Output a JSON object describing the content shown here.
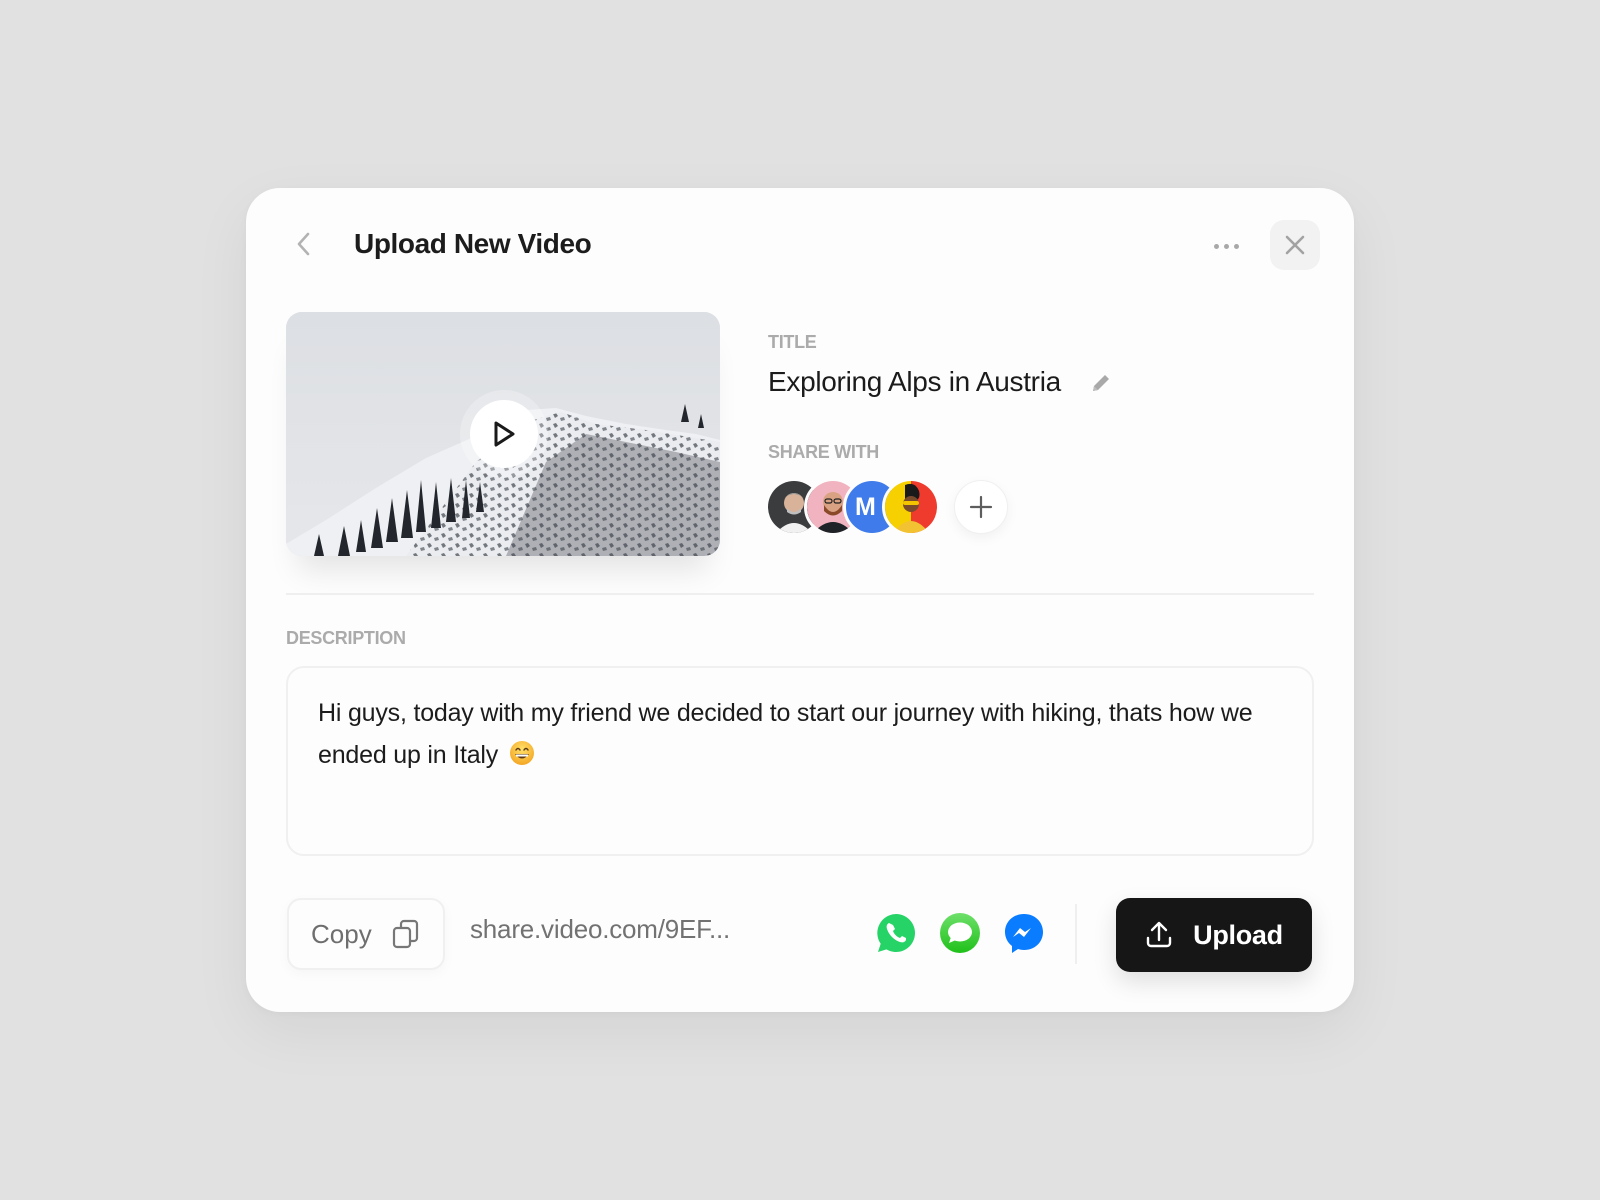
{
  "header": {
    "title": "Upload New Video",
    "back_icon": "chevron-left-icon",
    "more_icon": "more-horizontal-icon",
    "close_icon": "close-icon"
  },
  "video": {
    "thumbnail": "snowy-mountain-thumbnail",
    "play_icon": "play-icon"
  },
  "title_section": {
    "label": "TITLE",
    "value": "Exploring Alps in Austria",
    "edit_icon": "pencil-icon"
  },
  "share_section": {
    "label": "SHARE WITH",
    "avatars": [
      {
        "name": "user-1",
        "type": "photo"
      },
      {
        "name": "user-2",
        "type": "photo"
      },
      {
        "name": "user-3",
        "type": "initial",
        "initial": "M",
        "color": "#3f7bea"
      },
      {
        "name": "user-4",
        "type": "photo"
      }
    ],
    "add_icon": "plus-icon"
  },
  "description": {
    "label": "DESCRIPTION",
    "text": "Hi guys, today with my friend we decided to start our journey with hiking, thats how we ended up in Italy",
    "emoji": "grinning-face-emoji"
  },
  "footer": {
    "copy_label": "Copy",
    "copy_icon": "copy-icon",
    "share_link": "share.video.com/9EF...",
    "social": [
      {
        "name": "whatsapp",
        "color": "#25d366"
      },
      {
        "name": "messages",
        "color": "#34c759"
      },
      {
        "name": "messenger",
        "color": "#0a7cff"
      }
    ],
    "upload_label": "Upload",
    "upload_icon": "upload-icon"
  },
  "colors": {
    "background": "#e1e1e1",
    "card": "#fdfdfd",
    "primary_button": "#161616",
    "label_gray": "#ababab"
  }
}
